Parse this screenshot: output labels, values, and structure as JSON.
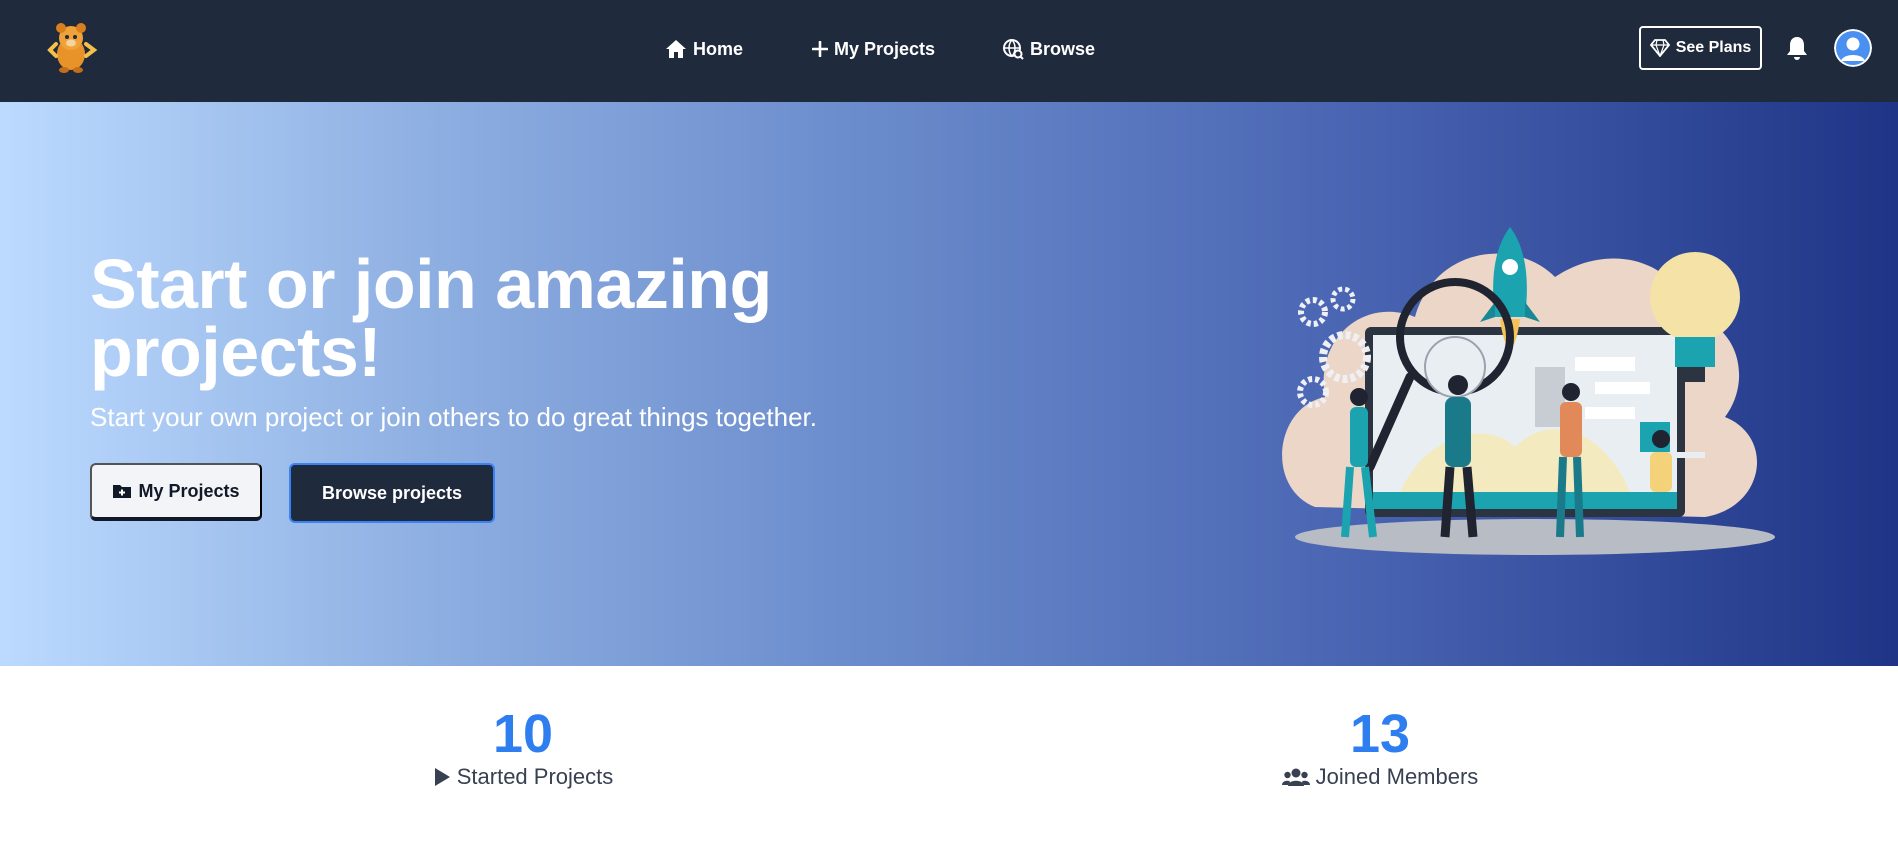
{
  "navbar": {
    "logo_icon": "bear-mascot-logo",
    "links": [
      {
        "label": "Home",
        "icon": "home-icon"
      },
      {
        "label": "My Projects",
        "icon": "plus-icon"
      },
      {
        "label": "Browse",
        "icon": "globe-search-icon"
      }
    ],
    "see_plans_label": "See Plans",
    "see_plans_icon": "diamond-icon",
    "bell_icon": "bell-icon",
    "avatar_icon": "user-avatar-icon"
  },
  "hero": {
    "title": "Start or join amazing projects!",
    "subtitle": "Start your own project or join others to do great things together.",
    "my_projects_button": "My Projects",
    "browse_button": "Browse projects",
    "illustration": "team-working-on-project-illustration"
  },
  "stats": [
    {
      "value": "10",
      "label": "Started Projects",
      "icon": "play-icon"
    },
    {
      "value": "13",
      "label": "Joined Members",
      "icon": "users-icon"
    }
  ],
  "colors": {
    "navbar_bg": "#1f2a3c",
    "accent_blue": "#2e7ef0",
    "hero_gradient_start": "#bcdaff",
    "hero_gradient_end": "#1f3486"
  }
}
